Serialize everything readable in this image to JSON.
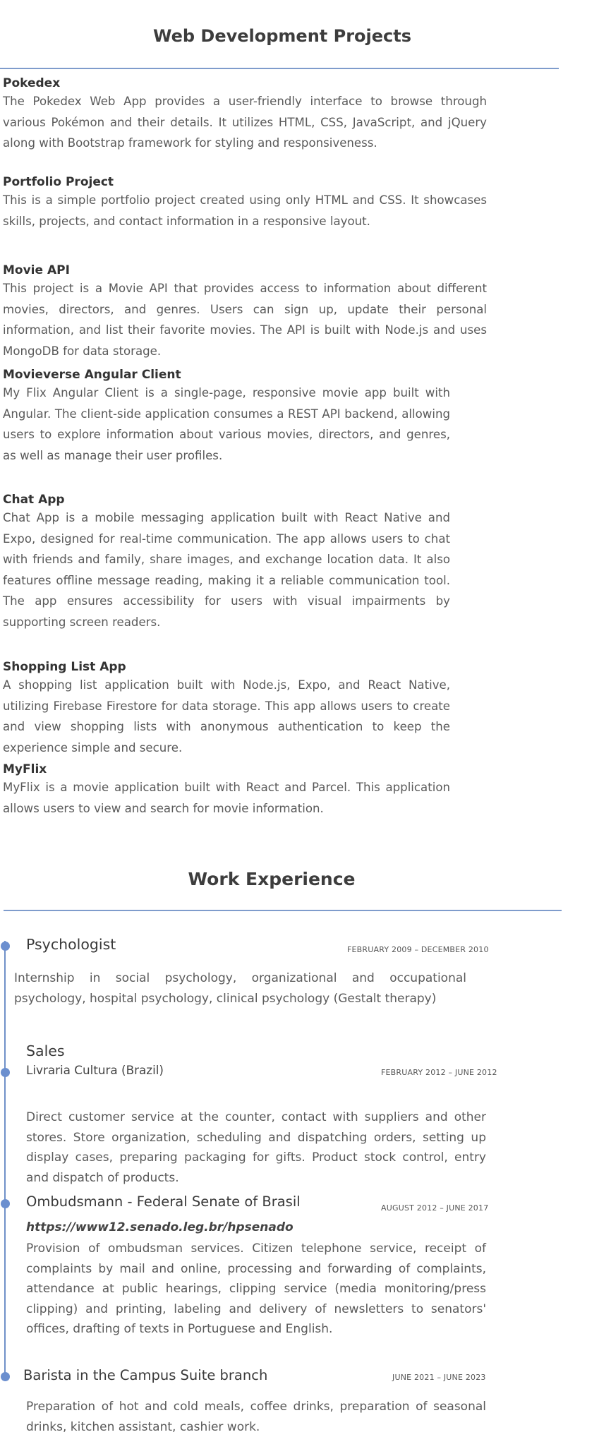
{
  "web_projects": {
    "heading": "Web Development Projects",
    "items": [
      {
        "title": "Pokedex",
        "description": "The Pokedex Web App provides a user-friendly interface to browse through various Pokémon and their details. It utilizes HTML, CSS, JavaScript, and jQuery along with Bootstrap framework for styling and responsiveness."
      },
      {
        "title": "Portfolio Project",
        "description": "This is a simple portfolio project created using only HTML and CSS. It showcases skills, projects, and contact information in a responsive layout."
      },
      {
        "title": "Movie API",
        "description": "This project is a Movie API that provides access to information about different movies, directors, and genres. Users can sign up, update their personal information, and list their favorite movies. The API is built with Node.js and uses MongoDB for data storage."
      },
      {
        "title": "Movieverse Angular Client",
        "description": "My Flix Angular Client is a single-page, responsive movie app built with Angular. The client-side application consumes a REST API backend, allowing users to explore information about various movies, directors, and genres, as well as manage their user profiles."
      },
      {
        "title": "Chat App",
        "description": "Chat App is a mobile messaging application built with React Native and Expo, designed for real-time communication. The app allows users to chat with friends and family, share images, and exchange location data. It also features offline message reading, making it a reliable communication tool. The app ensures accessibility for users with visual impairments by supporting screen readers."
      },
      {
        "title": "Shopping List App",
        "description": "A shopping list application built with Node.js, Expo, and React Native, utilizing Firebase Firestore for data storage. This app allows users to create and view shopping lists with anonymous authentication to keep the experience simple and secure."
      },
      {
        "title": "MyFlix",
        "description": "MyFlix is a movie application built with React and Parcel. This application allows users to view and search for movie information."
      }
    ]
  },
  "work_experience": {
    "heading": "Work Experience",
    "jobs": [
      {
        "title": "Psychologist",
        "dates": "FEBRUARY 2009 – DECEMBER 2010",
        "description": "Internship in social psychology, organizational and occupational psychology, hospital psychology, clinical psychology (Gestalt therapy)"
      },
      {
        "title": "Sales",
        "company": "Livraria Cultura (Brazil)",
        "dates": "FEBRUARY 2012 – JUNE 2012",
        "description": "Direct customer service at the counter, contact with suppliers and other stores. Store organization, scheduling and dispatching orders, setting up display cases, preparing packaging for gifts. Product stock control, entry and dispatch of products."
      },
      {
        "title": "Ombudsmann - Federal Senate of Brasil",
        "link": "https://www12.senado.leg.br/hpsenado",
        "dates": "AUGUST 2012 – JUNE 2017",
        "description": "Provision of ombudsman services. Citizen telephone service, receipt of complaints by mail and online, processing and forwarding of complaints, attendance at public hearings, clipping service (media monitoring/press clipping) and printing, labeling and delivery of newsletters to senators' offices, drafting of texts in Portuguese and English."
      },
      {
        "title": "Barista in the Campus Suite branch",
        "dates": "JUNE 2021 – JUNE 2023",
        "description": "Preparation of hot and cold meals, coffee drinks, preparation of seasonal drinks, kitchen assistant, cashier work."
      }
    ]
  }
}
